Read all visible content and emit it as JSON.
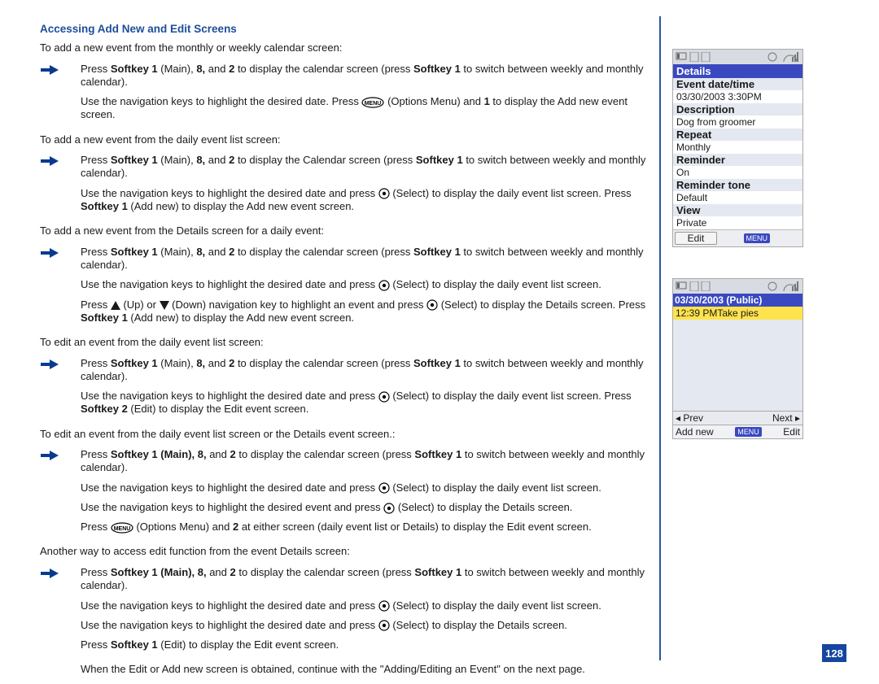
{
  "section_title": "Accessing Add New and Edit Screens",
  "intro_monthly": "To add a new event from the monthly or weekly calendar screen:",
  "monthly": {
    "step1a": "Press ",
    "step1b": " (Main), ",
    "step1c": " and ",
    "step1d": " to display the calendar screen (press ",
    "step1e": " to switch between weekly and monthly calendar).",
    "bsk1": "Softkey 1",
    "b8": "8,",
    "b2": "2",
    "bsk1b": "Softkey 1",
    "step2a": "Use the navigation keys to highlight the desired date. Press ",
    "step2b": " (Options Menu) and ",
    "b1": "1",
    "step2c": " to display the Add new event screen."
  },
  "intro_daily": "To add a new event from the daily event list screen:",
  "daily": {
    "step1a": "Press ",
    "bsk1": "Softkey 1",
    "step1b": " (Main), ",
    "b8": "8,",
    "step1c": " and ",
    "b2": "2",
    "step1d": " to display the Calendar screen (press ",
    "bsk1b": "Softkey 1",
    "step1e": " to switch between weekly and monthly calendar).",
    "step2a": "Use the navigation keys to highlight the desired date and press ",
    "step2b": " (Select) to display the daily event list screen. Press ",
    "bsk1c": "Softkey 1",
    "step2c": " (Add new) to display the Add new event screen."
  },
  "intro_details": "To add a new event from the Details screen for a daily event:",
  "details": {
    "step1a": "Press ",
    "bsk1": "Softkey 1",
    "step1b": " (Main), ",
    "b8": "8,",
    "step1c": " and ",
    "b2": "2",
    "step1d": " to display the calendar screen (press ",
    "bsk1b": "Softkey 1",
    "step1e": " to switch between weekly and monthly calendar).",
    "step2": "Use the navigation keys to highlight the desired date and press ",
    "step2b": " (Select) to display the daily event list screen.",
    "step3a": "Press ",
    "step3b": " (Up) or ",
    "step3c": " (Down) navigation key to highlight an event and press ",
    "step3d": " (Select) to display the Details screen. Press ",
    "bsk1c": "Softkey 1",
    "step3e": " (Add new) to display the Add new event screen."
  },
  "intro_edit_daily": "To edit an event from the daily event list screen:",
  "edit_daily": {
    "step1a": "Press ",
    "bsk1": "Softkey 1",
    "step1b": " (Main), ",
    "b8": "8,",
    "step1c": " and ",
    "b2": "2",
    "step1d": " to display the calendar screen (press ",
    "bsk1b": "Softkey 1",
    "step1e": " to switch between weekly and monthly calendar).",
    "step2a": "Use the navigation keys to highlight the desired date and press ",
    "step2b": " (Select) to display the daily event list screen. Press ",
    "bsk2": "Softkey 2",
    "step2c": " (Edit) to display the Edit event screen."
  },
  "intro_edit_both": "To edit an event from the daily event list screen or the Details event screen.:",
  "edit_both": {
    "step1a": "Press ",
    "bsk1": "Softkey 1 (Main), 8,",
    "step1c": " and ",
    "b2": "2",
    "step1d": " to display the calendar screen (press ",
    "bsk1b": "Softkey 1",
    "step1e": " to switch between weekly and monthly calendar).",
    "step2a": "Use the navigation keys to highlight the desired date and press ",
    "step2b": " (Select) to display the daily event list screen.",
    "step3a": "Use the navigation keys to highlight the desired event and press ",
    "step3b": " (Select) to display the Details screen.",
    "step4a": "Press ",
    "step4b": " (Options Menu) and ",
    "b2b": "2",
    "step4c": " at either screen (daily event list or Details) to display the Edit event screen."
  },
  "intro_another": "Another way to access edit function from the event Details screen:",
  "another": {
    "step1a": "Press ",
    "bsk1": "Softkey 1 (Main), 8,",
    "step1c": " and ",
    "b2": "2",
    "step1d": " to display the calendar screen (press ",
    "bsk1b": "Softkey 1",
    "step1e": " to switch between weekly and monthly calendar).",
    "step2a": "Use the navigation keys to highlight the desired date and press ",
    "step2b": " (Select) to display the daily event list screen.",
    "step3a": "Use the navigation keys to highlight the desired date and press ",
    "step3b": " (Select) to display the Details screen.",
    "step4a": "Press ",
    "bsk1c": "Softkey 1",
    "step4b": " (Edit) to display the Edit event screen.",
    "step5": "When the Edit or Add new screen is obtained, continue with the \"Adding/Editing an Event\" on the next page."
  },
  "phone1": {
    "title": "Details",
    "l1": "Event date/time",
    "v1": "03/30/2003  3:30PM",
    "l2": "Description",
    "v2": "Dog from groomer",
    "l3": "Repeat",
    "v3": "Monthly",
    "l4": "Reminder",
    "v4": "On",
    "l5": "Reminder tone",
    "v5": "Default",
    "l6": "View",
    "v6": "Private",
    "soft_edit": "Edit",
    "soft_menu": "MENU"
  },
  "phone2": {
    "title": "03/30/2003 (Public)",
    "row": "12:39 PMTake pies",
    "prev": "◂ Prev",
    "next": "Next ▸",
    "addnew": "Add new",
    "menu": "MENU",
    "edit": "Edit"
  },
  "page_number": "128"
}
